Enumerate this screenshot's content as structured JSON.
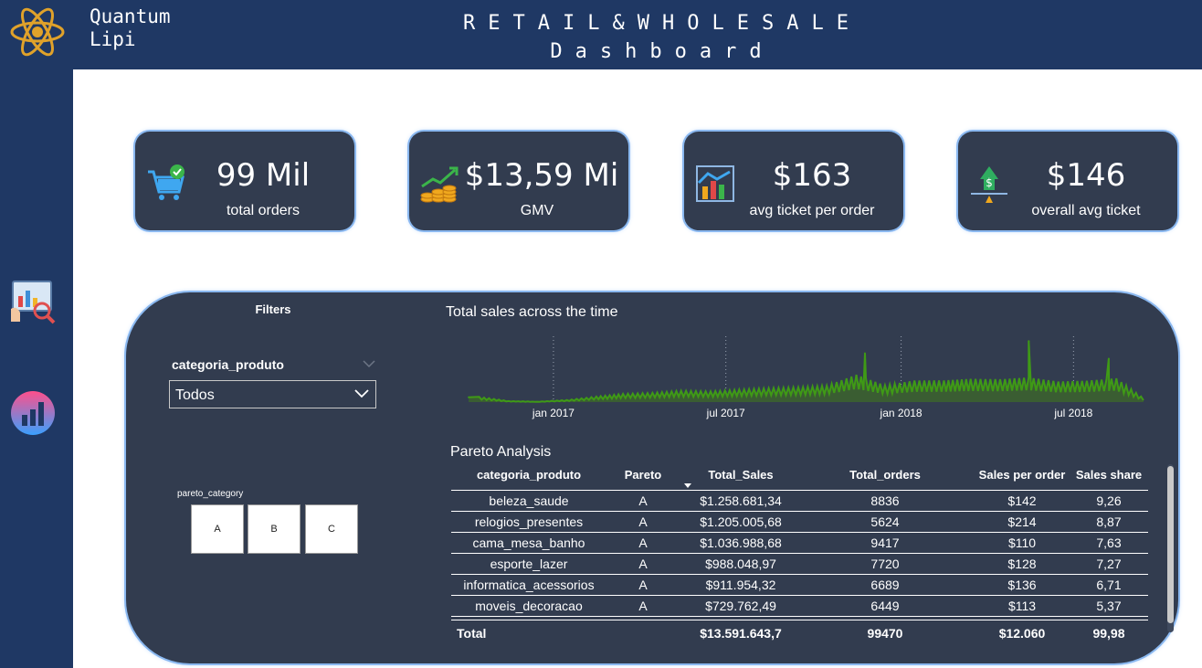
{
  "header": {
    "brand_line1": "Quantum",
    "brand_line2": "Lipi",
    "title_line1": "RETAIL&WHOLESALE",
    "title_line2": "Dashboard"
  },
  "sidebar": {
    "items": [
      {
        "icon": "report-search-icon"
      },
      {
        "icon": "bar-chart-icon"
      }
    ]
  },
  "kpis": [
    {
      "value": "99 Mil",
      "label": "total orders",
      "icon": "shopping-cart-icon"
    },
    {
      "value": "$13,59 Mi",
      "label": "GMV",
      "icon": "coins-growth-icon"
    },
    {
      "value": "$163",
      "label": "avg ticket per order",
      "icon": "bar-chart-trend-icon"
    },
    {
      "value": "$146",
      "label": "overall avg ticket",
      "icon": "money-balance-icon"
    }
  ],
  "filters": {
    "title": "Filters",
    "category_label": "categoria_produto",
    "category_value": "Todos",
    "pareto_label": "pareto_category",
    "pareto_options": [
      "A",
      "B",
      "C"
    ]
  },
  "colors": {
    "header_bg": "#1f3864",
    "panel_bg": "#323c4f",
    "panel_glow": "#8ab8f0",
    "line": "#3f9a16",
    "area": "#3a5d32"
  },
  "chart_data": {
    "type": "area",
    "title": "Total sales across the time",
    "x_tick_labels": [
      "jan 2017",
      "jul 2017",
      "jan 2018",
      "jul 2018"
    ],
    "x": [
      "2016-10",
      "2016-11",
      "2016-12",
      "2017-01",
      "2017-02",
      "2017-03",
      "2017-04",
      "2017-05",
      "2017-06",
      "2017-07",
      "2017-08",
      "2017-09",
      "2017-10",
      "2017-11",
      "2017-12",
      "2018-01",
      "2018-02",
      "2018-03",
      "2018-04",
      "2018-05",
      "2018-06",
      "2018-07",
      "2018-08",
      "2018-09"
    ],
    "values": [
      4000,
      800,
      300,
      1600,
      4200,
      6300,
      7100,
      8700,
      8200,
      9600,
      10700,
      11400,
      12600,
      21000,
      12900,
      16500,
      16600,
      17800,
      17500,
      18900,
      15700,
      16400,
      18200,
      1500
    ],
    "peaks": [
      {
        "x": "2016-10-04",
        "value": 15000
      },
      {
        "x": "2017-11-24",
        "value": 152000
      },
      {
        "x": "2018-05-15",
        "value": 190000
      },
      {
        "x": "2018-08-07",
        "value": 135000
      }
    ],
    "grid": false,
    "xlabel": "",
    "ylabel": ""
  },
  "table": {
    "title": "Pareto Analysis",
    "headers": [
      "categoria_produto",
      "Pareto",
      "Total_Sales",
      "Total_orders",
      "Sales per order",
      "Sales share"
    ],
    "rows": [
      [
        "beleza_saude",
        "A",
        "$1.258.681,34",
        "8836",
        "$142",
        "9,26"
      ],
      [
        "relogios_presentes",
        "A",
        "$1.205.005,68",
        "5624",
        "$214",
        "8,87"
      ],
      [
        "cama_mesa_banho",
        "A",
        "$1.036.988,68",
        "9417",
        "$110",
        "7,63"
      ],
      [
        "esporte_lazer",
        "A",
        "$988.048,97",
        "7720",
        "$128",
        "7,27"
      ],
      [
        "informatica_acessorios",
        "A",
        "$911.954,32",
        "6689",
        "$136",
        "6,71"
      ],
      [
        "moveis_decoracao",
        "A",
        "$729.762,49",
        "6449",
        "$113",
        "5,37"
      ]
    ],
    "total": [
      "Total",
      "",
      "$13.591.643,7",
      "99470",
      "$12.060",
      "99,98"
    ]
  }
}
